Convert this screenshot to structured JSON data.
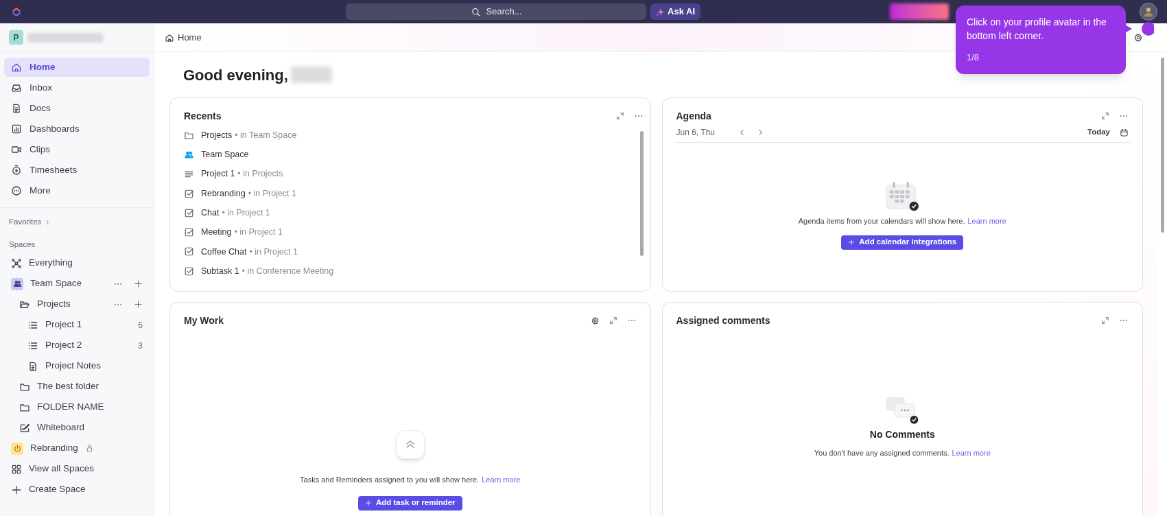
{
  "topbar": {
    "search_placeholder": "Search...",
    "ask_ai": "Ask AI"
  },
  "sidebar": {
    "workspace_initial": "P",
    "nav": [
      {
        "label": "Home",
        "kind": "home",
        "selected": true
      },
      {
        "label": "Inbox",
        "kind": "inbox",
        "selected": false
      },
      {
        "label": "Docs",
        "kind": "doc",
        "selected": false
      },
      {
        "label": "Dashboards",
        "kind": "dashboard",
        "selected": false
      },
      {
        "label": "Clips",
        "kind": "clip",
        "selected": false
      },
      {
        "label": "Timesheets",
        "kind": "timer",
        "selected": false
      },
      {
        "label": "More",
        "kind": "more",
        "selected": false
      }
    ],
    "favorites": "Favorites",
    "spaces_heading": "Spaces",
    "spaces": [
      {
        "label": "Everything",
        "kind": "everything"
      },
      {
        "label": "Team Space",
        "kind": "team",
        "actions": true,
        "children": [
          {
            "label": "Projects",
            "kind": "folder-open",
            "actions": true,
            "children": [
              {
                "label": "Project 1",
                "kind": "list",
                "count": "6"
              },
              {
                "label": "Project 2",
                "kind": "list",
                "count": "3"
              },
              {
                "label": "Project Notes",
                "kind": "doc"
              }
            ]
          },
          {
            "label": "The best folder",
            "kind": "folder"
          },
          {
            "label": "FOLDER NAME",
            "kind": "folder"
          },
          {
            "label": "Whiteboard",
            "kind": "whiteboard"
          }
        ]
      },
      {
        "label": "Rebranding",
        "kind": "power",
        "locked": true
      },
      {
        "label": "View all Spaces",
        "kind": "grid"
      },
      {
        "label": "Create Space",
        "kind": "plus"
      }
    ]
  },
  "breadcrumb": "Home",
  "greeting": "Good evening,",
  "recents": {
    "title": "Recents",
    "items": [
      {
        "name": "Projects",
        "location": "• in Team Space",
        "kind": "folder"
      },
      {
        "name": "Team Space",
        "kind": "team"
      },
      {
        "name": "Project 1",
        "location": "• in Projects",
        "kind": "lines"
      },
      {
        "name": "Rebranding",
        "location": "• in Project 1",
        "kind": "task"
      },
      {
        "name": "Chat",
        "location": "• in Project 1",
        "kind": "task"
      },
      {
        "name": "Meeting",
        "location": "• in Project 1",
        "kind": "task"
      },
      {
        "name": "Coffee Chat",
        "location": "• in Project 1",
        "kind": "task"
      },
      {
        "name": "Subtask 1",
        "location": "• in Conference Meeting",
        "kind": "task"
      }
    ]
  },
  "agenda": {
    "title": "Agenda",
    "date": "Jun 6, Thu",
    "today": "Today",
    "message": "Agenda items from your calendars will show here.",
    "link": "Learn more",
    "button": "Add calendar integrations"
  },
  "my_work": {
    "title": "My Work",
    "message": "Tasks and Reminders assigned to you will show here.",
    "link": "Learn more",
    "button": "Add task or reminder"
  },
  "comments": {
    "title": "Assigned comments",
    "heading": "No Comments",
    "message": "You don't have any assigned comments.",
    "link": "Learn more"
  },
  "tour": {
    "text": "Click on your profile avatar in the bottom left corner.",
    "step": "1/8"
  }
}
